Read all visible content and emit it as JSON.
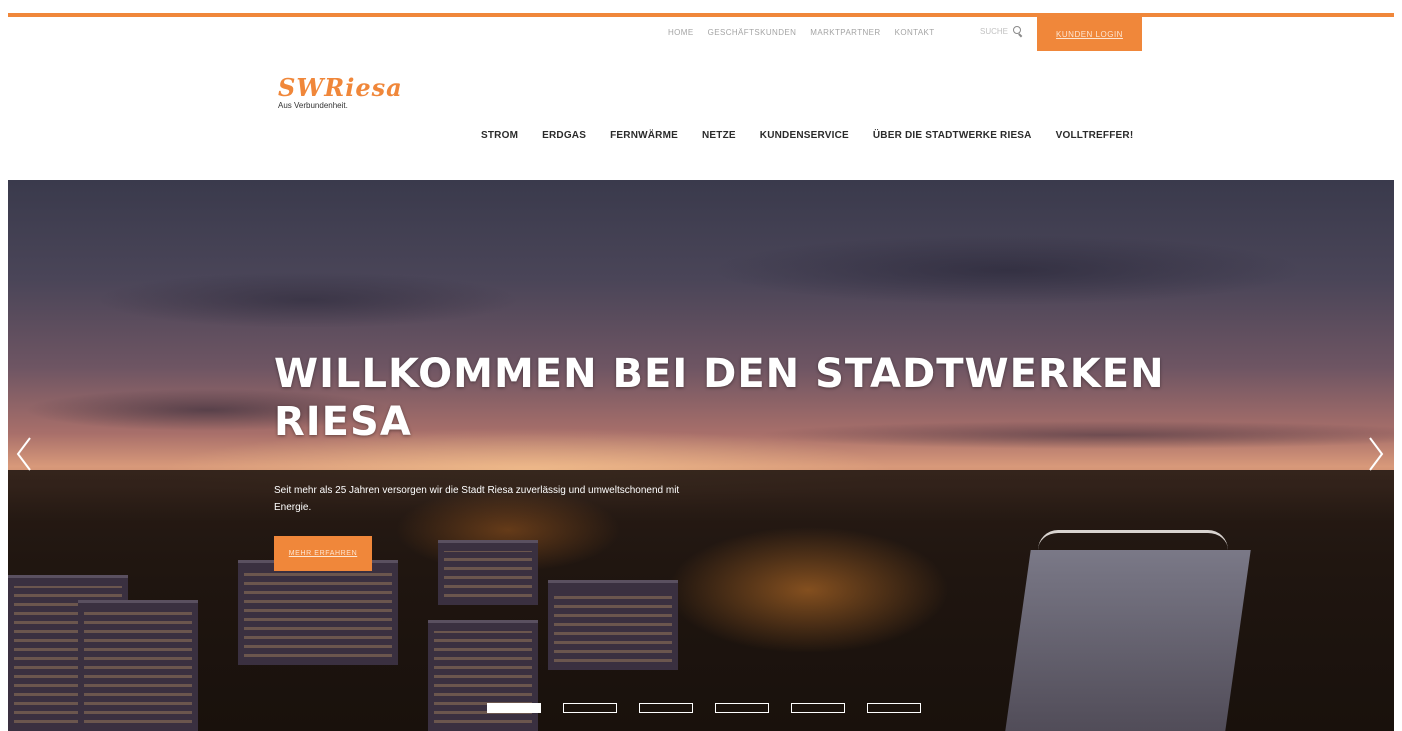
{
  "colors": {
    "accent": "#f0873a",
    "nav_text": "#2b2b2b",
    "utility_text": "#a4a4a4"
  },
  "utility_nav": [
    "HOME",
    "GESCHÄFTSKUNDEN",
    "MARKTPARTNER",
    "KONTAKT"
  ],
  "search": {
    "placeholder": "SUCHE",
    "icon": "search-icon"
  },
  "login": {
    "label": "KUNDEN LOGIN"
  },
  "logo": {
    "wordmark": "SWRiesa",
    "tagline": "Aus Verbundenheit."
  },
  "main_nav": [
    "STROM",
    "ERDGAS",
    "FERNWÄRME",
    "NETZE",
    "KUNDENSERVICE",
    "ÜBER DIE STADTWERKE RIESA",
    "VOLLTREFFER!"
  ],
  "hero": {
    "title": "WILLKOMMEN BEI DEN STADTWERKEN RIESA",
    "text": "Seit mehr als 25 Jahren versorgen wir die Stadt Riesa zuverlässig und umweltschonend mit Energie.",
    "cta": "MEHR ERFAHREN",
    "slides": 6,
    "active_slide": 1,
    "prev_icon": "chevron-left-icon",
    "next_icon": "chevron-right-icon"
  }
}
